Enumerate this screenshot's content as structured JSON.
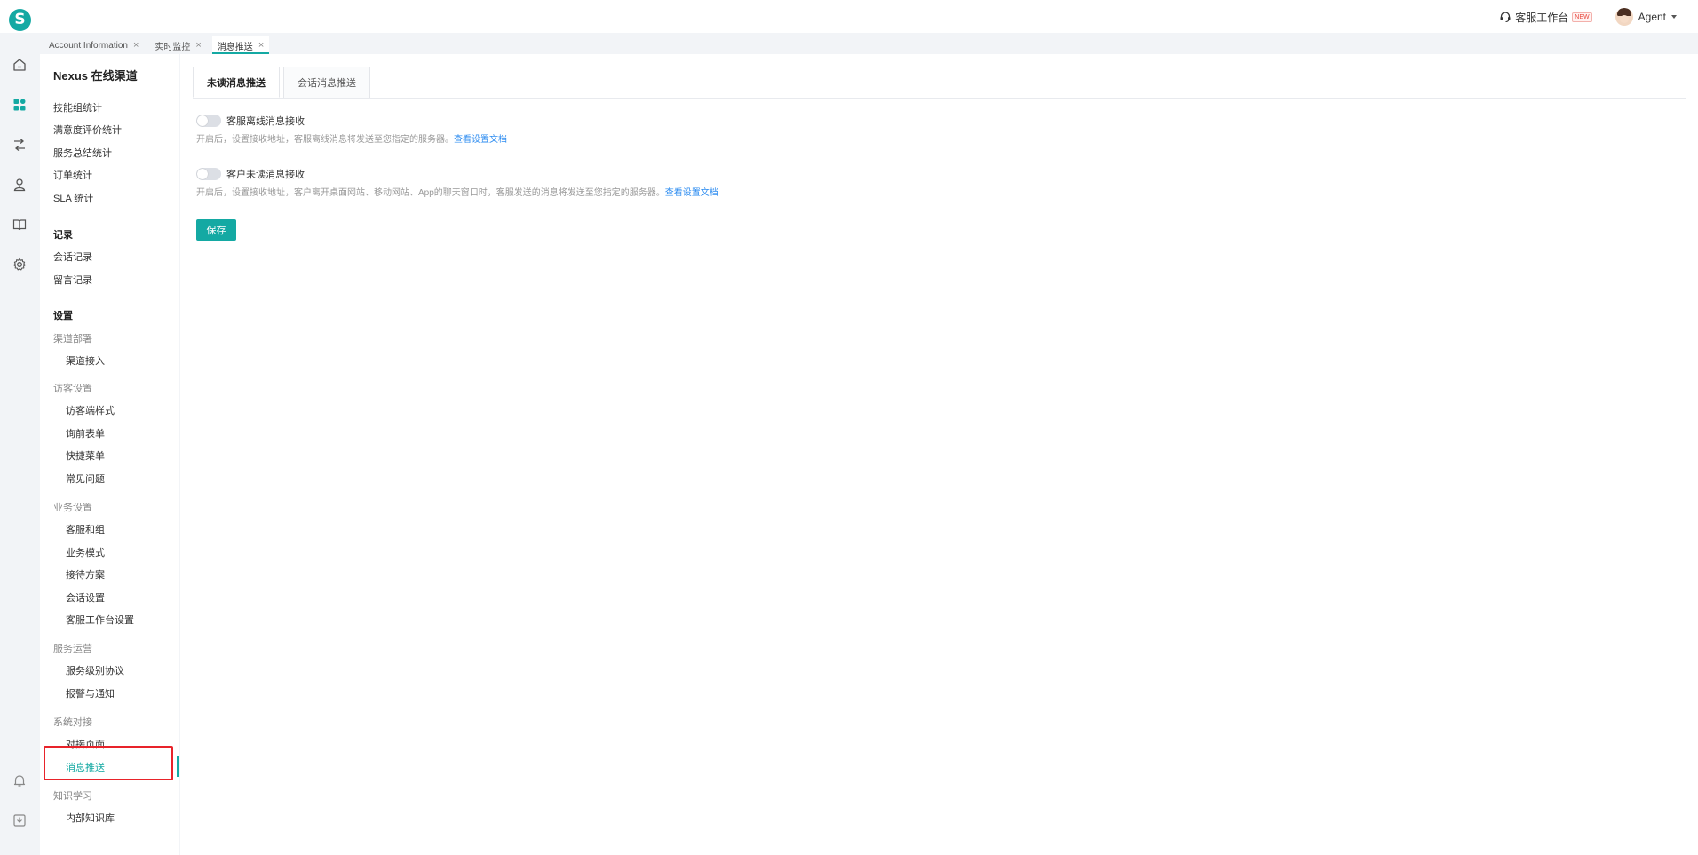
{
  "header": {
    "logo_letter": "S",
    "workspace_label": "客服工作台",
    "new_badge": "NEW",
    "user_name": "Agent"
  },
  "rail_icons": [
    "home-icon",
    "dashboard-icon",
    "routing-icon",
    "user-service-icon",
    "book-icon",
    "gear-icon",
    "bell-icon",
    "download-icon"
  ],
  "tabs": [
    {
      "label": "Account Information"
    },
    {
      "label": "实时监控"
    },
    {
      "label": "消息推送"
    }
  ],
  "sidebar": {
    "title": "Nexus 在线渠道",
    "stats_items": [
      "技能组统计",
      "满意度评价统计",
      "服务总结统计",
      "订单统计",
      "SLA 统计"
    ],
    "records_heading": "记录",
    "records_items": [
      "会话记录",
      "留言记录"
    ],
    "settings_heading": "设置",
    "groups": [
      {
        "label": "渠道部署",
        "items": [
          "渠道接入"
        ]
      },
      {
        "label": "访客设置",
        "items": [
          "访客端样式",
          "询前表单",
          "快捷菜单",
          "常见问题"
        ]
      },
      {
        "label": "业务设置",
        "items": [
          "客服和组",
          "业务模式",
          "接待方案",
          "会话设置",
          "客服工作台设置"
        ]
      },
      {
        "label": "服务运营",
        "items": [
          "服务级别协议",
          "报警与通知"
        ]
      },
      {
        "label": "系统对接",
        "items": [
          "对接页面",
          "消息推送"
        ]
      },
      {
        "label": "知识学习",
        "items": [
          "内部知识库"
        ]
      }
    ]
  },
  "content": {
    "tabs": [
      "未读消息推送",
      "会话消息推送"
    ],
    "settings": [
      {
        "label": "客服离线消息接收",
        "desc": "开启后，设置接收地址，客服离线消息将发送至您指定的服务器。",
        "link": "查看设置文档",
        "enabled": false
      },
      {
        "label": "客户未读消息接收",
        "desc": "开启后，设置接收地址，客户离开桌面网站、移动网站、App的聊天窗口时，客服发送的消息将发送至您指定的服务器。",
        "link": "查看设置文档",
        "enabled": false
      }
    ],
    "save_label": "保存"
  },
  "colors": {
    "accent": "#14a9a3",
    "link": "#2d8cf0",
    "highlight": "#e8232a"
  }
}
